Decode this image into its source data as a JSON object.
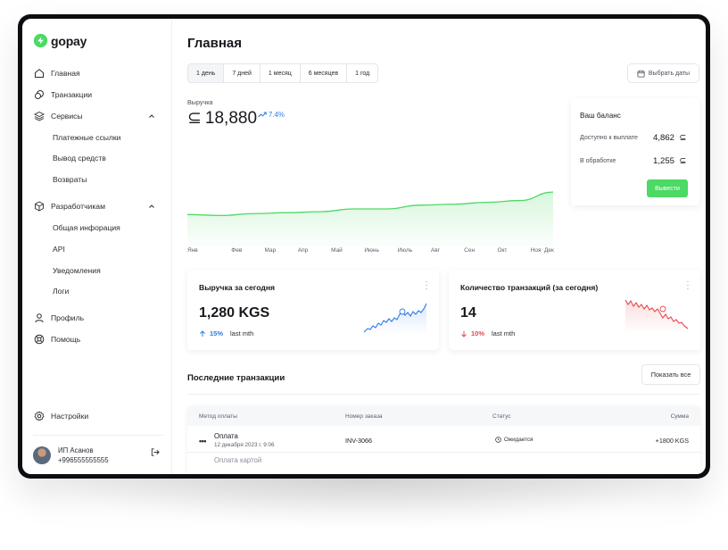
{
  "app": {
    "logo_text": "gopay",
    "brand_color": "#4cd964"
  },
  "sidebar": {
    "items": [
      {
        "label": "Главная",
        "icon": "home-icon"
      },
      {
        "label": "Транзакции",
        "icon": "coins-icon"
      },
      {
        "label": "Сервисы",
        "icon": "layers-icon",
        "expanded": true
      },
      {
        "label": "Разработчикам",
        "icon": "cube-icon",
        "expanded": true
      },
      {
        "label": "Профиль",
        "icon": "user-icon"
      },
      {
        "label": "Помощь",
        "icon": "lifebuoy-icon"
      }
    ],
    "services_sub": [
      "Платежные ссылки",
      "Вывод средств",
      "Возвраты"
    ],
    "dev_sub": [
      "Общая инфорация",
      "API",
      "Уведомления",
      "Логи"
    ],
    "settings_label": "Настройки",
    "user": {
      "name": "ИП Асанов",
      "phone": "+996555555555"
    }
  },
  "main": {
    "title": "Главная",
    "ranges": [
      "1 день",
      "7 дней",
      "1 месяц",
      "6 месяцев",
      "1 год"
    ],
    "active_range": "1 день",
    "date_picker_label": "Выбрать даты",
    "revenue": {
      "label": "Выручка",
      "currency": "⊆",
      "value": "18,880",
      "change": "7.4%"
    }
  },
  "balance": {
    "title": "Ваш баланс",
    "available_label": "Доступно к выплате",
    "available_value": "4,862",
    "processing_label": "В обработке",
    "processing_value": "1,255",
    "currency": "⊆",
    "withdraw_label": "Вывести"
  },
  "stats": {
    "revenue_today": {
      "title": "Выручка за сегодня",
      "value": "1,280 KGS",
      "delta": "15%",
      "delta_suffix": "last mth",
      "color": "#2f7ae5"
    },
    "tx_count_today": {
      "title": "Количество транзакций (за сегодня)",
      "value": "14",
      "delta": "10%",
      "delta_suffix": "last mth",
      "color": "#e5484d"
    }
  },
  "transactions": {
    "title": "Последние транзакции",
    "show_all_label": "Показать все",
    "columns": [
      "Метод оплаты",
      "Номер заказа",
      "Статус",
      "Сумма"
    ],
    "rows": [
      {
        "method": "Оплата",
        "date": "12 декабря 2023 г. 9:06",
        "order": "INV-3066",
        "status": "Ожидается",
        "amount": "+1800 KGS"
      },
      {
        "method": "Оплата картой"
      }
    ]
  },
  "chart_data": {
    "type": "area",
    "categories": [
      "Янв",
      "Фев",
      "Мар",
      "Апр",
      "Май",
      "Июнь",
      "Июль",
      "Авг",
      "Сен",
      "Окт",
      "Ноя",
      "Дек"
    ],
    "values": [
      0.34,
      0.33,
      0.35,
      0.36,
      0.37,
      0.4,
      0.4,
      0.44,
      0.45,
      0.47,
      0.49,
      0.58
    ],
    "series_color": "#4cd964",
    "grid": false
  }
}
